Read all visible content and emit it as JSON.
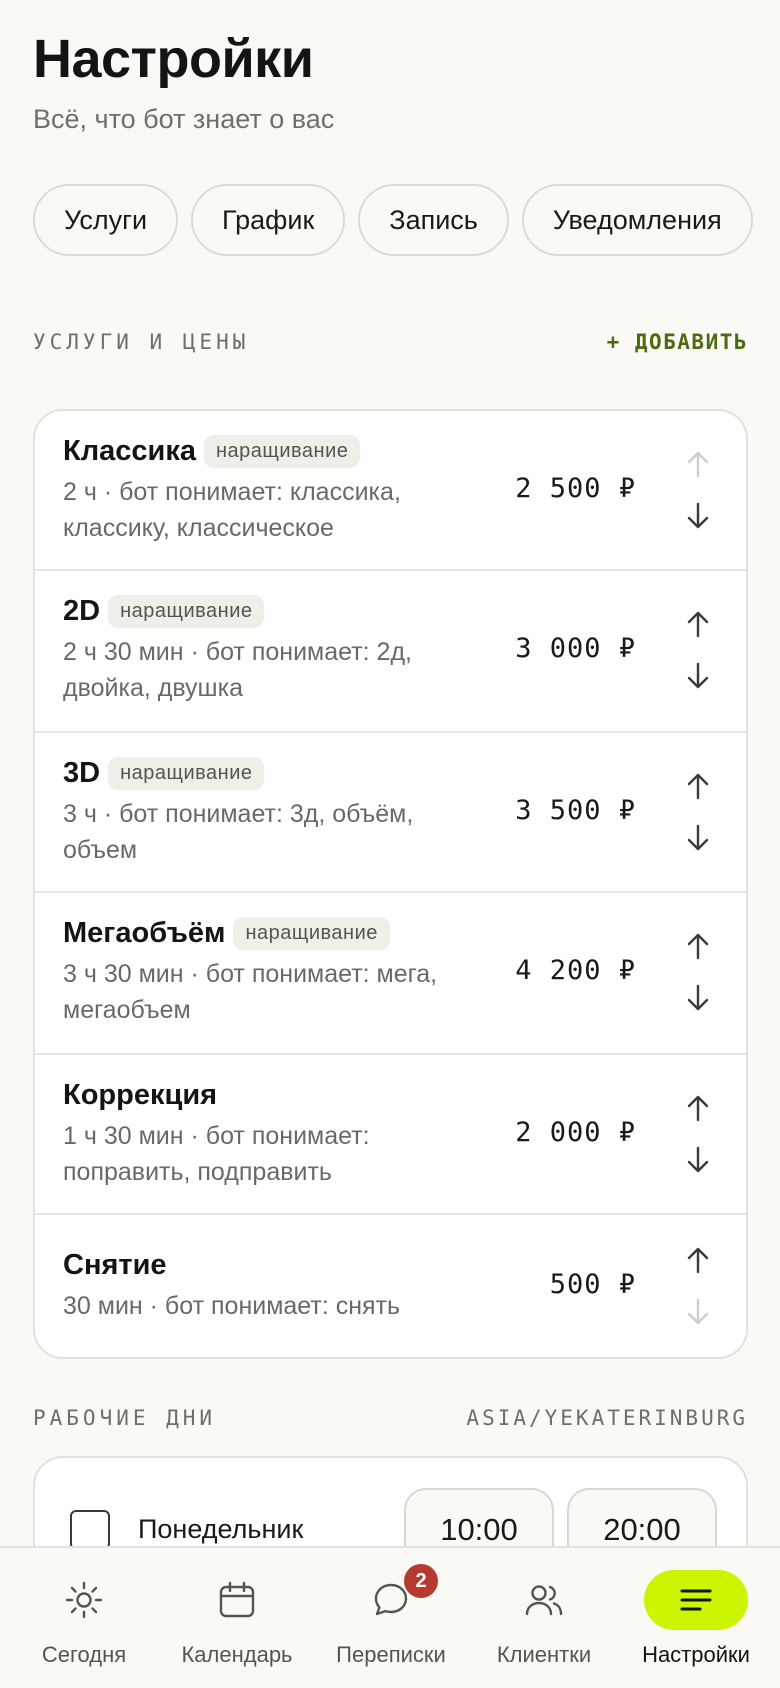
{
  "header": {
    "title": "Настройки",
    "subtitle": "Всё, что бот знает о вас"
  },
  "tabs": [
    {
      "label": "Услуги"
    },
    {
      "label": "График"
    },
    {
      "label": "Запись"
    },
    {
      "label": "Уведомления"
    }
  ],
  "services_section": {
    "label": "УСЛУГИ И ЦЕНЫ",
    "add_label": "+ ДОБАВИТЬ",
    "items": [
      {
        "name": "Классика",
        "tag": "наращивание",
        "desc": "2 ч · бот понимает: классика, классику, классическое",
        "price": "2 500 ₽",
        "up_enabled": false,
        "down_enabled": true
      },
      {
        "name": "2D",
        "tag": "наращивание",
        "desc": "2 ч 30 мин · бот понимает: 2д, двойка, двушка",
        "price": "3 000 ₽",
        "up_enabled": true,
        "down_enabled": true
      },
      {
        "name": "3D",
        "tag": "наращивание",
        "desc": "3 ч · бот понимает: 3д, объём, объем",
        "price": "3 500 ₽",
        "up_enabled": true,
        "down_enabled": true
      },
      {
        "name": "Мегаобъём",
        "tag": "наращивание",
        "desc": "3 ч 30 мин · бот понимает: мега, мегаобъем",
        "price": "4 200 ₽",
        "up_enabled": true,
        "down_enabled": true
      },
      {
        "name": "Коррекция",
        "tag": "",
        "desc": "1 ч 30 мин · бот понимает: поправить, подправить",
        "price": "2 000 ₽",
        "up_enabled": true,
        "down_enabled": true
      },
      {
        "name": "Снятие",
        "tag": "",
        "desc": "30 мин · бот понимает: снять",
        "price": "500 ₽",
        "up_enabled": true,
        "down_enabled": false
      }
    ]
  },
  "work_days": {
    "label": "РАБОЧИЕ ДНИ",
    "timezone": "ASIA/YEKATERINBURG",
    "first_day": {
      "name": "Понедельник",
      "checked": false,
      "start": "10:00",
      "end": "20:00"
    }
  },
  "bottom_nav": {
    "items": [
      {
        "label": "Сегодня",
        "icon": "sun-icon"
      },
      {
        "label": "Календарь",
        "icon": "calendar-icon"
      },
      {
        "label": "Переписки",
        "icon": "chat-bubble-icon",
        "badge": "2"
      },
      {
        "label": "Клиентки",
        "icon": "users-icon"
      },
      {
        "label": "Настройки",
        "icon": "menu-lines-icon",
        "active": true
      }
    ]
  },
  "colors": {
    "background": "#faf9f5",
    "accent": "#ccf500",
    "add_link": "#4a6b10",
    "badge": "#b73a2e"
  }
}
